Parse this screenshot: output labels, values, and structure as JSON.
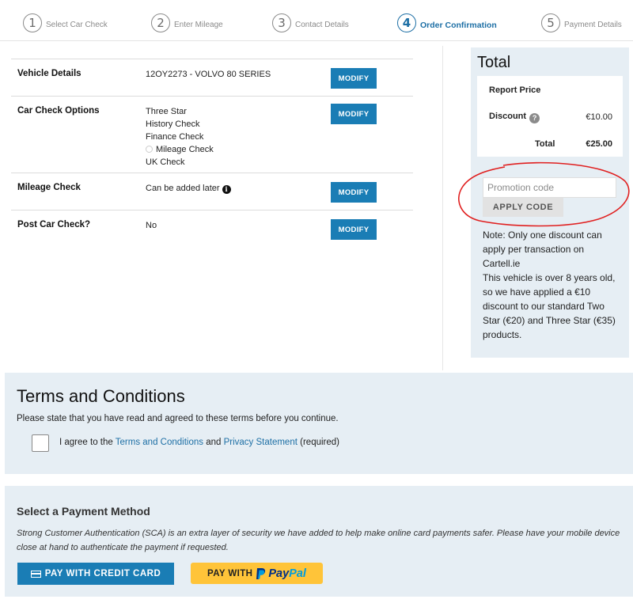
{
  "stepper": {
    "steps": [
      {
        "num": "1",
        "label": "Select Car Check"
      },
      {
        "num": "2",
        "label": "Enter Mileage"
      },
      {
        "num": "3",
        "label": "Contact Details"
      },
      {
        "num": "4",
        "label": "Order Confirmation"
      },
      {
        "num": "5",
        "label": "Payment Details"
      }
    ],
    "active_step": 4
  },
  "details": {
    "modify_label": "MODIFY",
    "rows": [
      {
        "label": "Vehicle Details",
        "value": "12OY2273 - VOLVO 80 SERIES"
      },
      {
        "label": "Car Check Options",
        "options": [
          "Three Star",
          "History Check",
          "Finance Check",
          "Mileage Check",
          "UK Check"
        ]
      },
      {
        "label": "Mileage Check",
        "value": "Can be added later"
      },
      {
        "label": "Post Car Check?",
        "value": "No"
      }
    ]
  },
  "total": {
    "title": "Total",
    "report_price_label": "Report Price",
    "discount_label": "Discount",
    "discount_value": "€10.00",
    "total_label": "Total",
    "total_value": "€25.00",
    "promo_placeholder": "Promotion code",
    "apply_label": "APPLY CODE",
    "note": "Note: Only one discount can apply per transaction on Cartell.ie\nThis vehicle is over 8 years old, so we have applied a €10 discount to our standard Two Star (€20) and Three Star (€35) products."
  },
  "terms": {
    "title": "Terms and Conditions",
    "subtitle": "Please state that you have read and agreed to these terms before you continue.",
    "agree_prefix": "I agree to the",
    "terms_link": "Terms and Conditions",
    "and": "and",
    "privacy_link": "Privacy Statement",
    "required": "(required)"
  },
  "payment": {
    "title": "Select a Payment Method",
    "sca_text": "Strong Customer Authentication (SCA) is an extra layer of security we have added to help make online card payments safer. Please have your mobile device close at hand to authenticate the payment if requested.",
    "credit_card_label": "PAY WITH CREDIT CARD",
    "paypal_prefix": "PAY WITH",
    "paypal_pay": "Pay",
    "paypal_pal": "Pal"
  },
  "colors": {
    "accent": "#1a7db5",
    "panel_bg": "#e6eef4",
    "paypal_yellow": "#ffc439",
    "annotation_red": "#e02020"
  }
}
